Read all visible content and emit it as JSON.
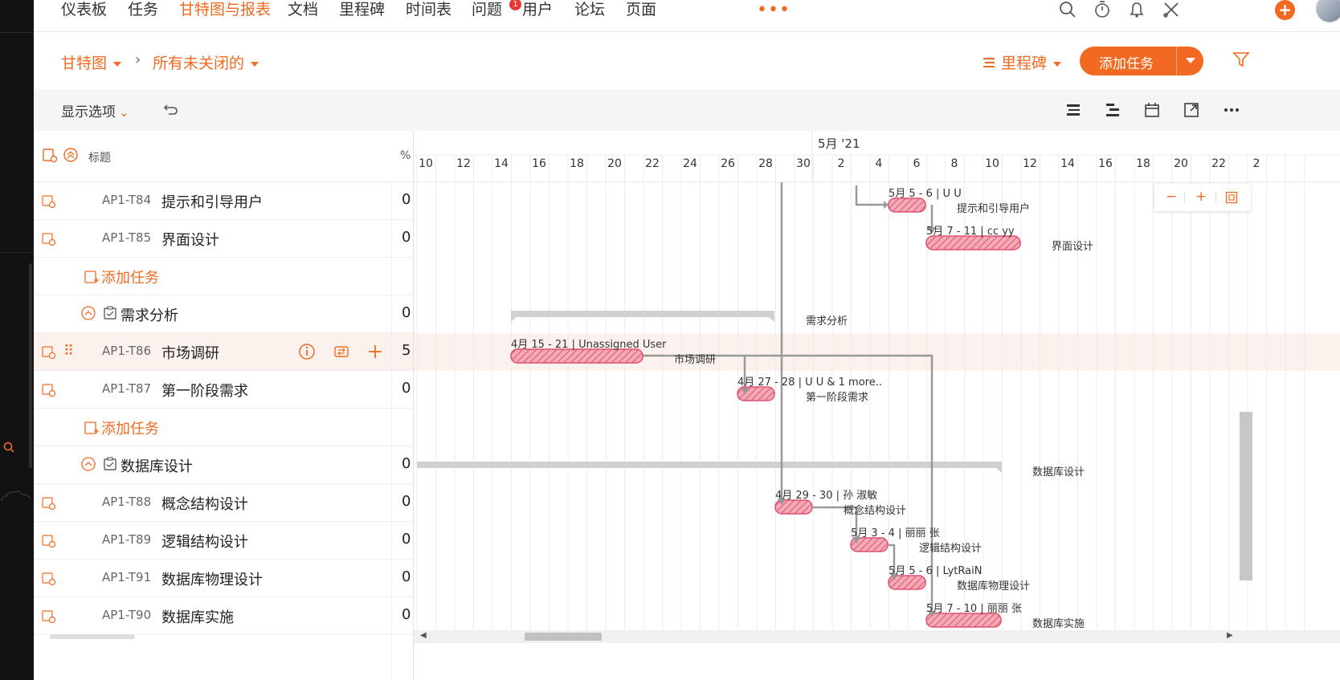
{
  "nav": {
    "items": [
      "仪表板",
      "任务",
      "甘特图与报表",
      "文档",
      "里程碑",
      "时间表",
      "问题",
      "用户",
      "论坛",
      "页面"
    ],
    "active_index": 2,
    "timesheet_badge": "1",
    "more": "•••"
  },
  "crumbs": {
    "root": "甘特图",
    "view": "所有未关闭的",
    "separator": "›",
    "milestone": "里程碑",
    "add_task": "添加任务"
  },
  "toolbar": {
    "display_options": "显示选项"
  },
  "grid": {
    "title_header": "标题",
    "percent_header": "%",
    "rows": [
      {
        "type": "task",
        "code": "AP1-T84",
        "name": "提示和引导用户",
        "value": "0"
      },
      {
        "type": "task",
        "code": "AP1-T85",
        "name": "界面设计",
        "value": "0"
      },
      {
        "type": "add",
        "label": "添加任务"
      },
      {
        "type": "group",
        "name": "需求分析",
        "value": "0"
      },
      {
        "type": "task",
        "code": "AP1-T86",
        "name": "市场调研",
        "value": "5",
        "selected": true
      },
      {
        "type": "task",
        "code": "AP1-T87",
        "name": "第一阶段需求",
        "value": "0"
      },
      {
        "type": "add",
        "label": "添加任务"
      },
      {
        "type": "group",
        "name": "数据库设计",
        "value": "0"
      },
      {
        "type": "task",
        "code": "AP1-T88",
        "name": "概念结构设计",
        "value": "0"
      },
      {
        "type": "task",
        "code": "AP1-T89",
        "name": "逻辑结构设计",
        "value": "0"
      },
      {
        "type": "task",
        "code": "AP1-T91",
        "name": "数据库物理设计",
        "value": "0"
      },
      {
        "type": "task",
        "code": "AP1-T90",
        "name": "数据库实施",
        "value": "0"
      }
    ]
  },
  "timeline": {
    "month_label": "5月 '21",
    "ticks": [
      "10",
      "12",
      "14",
      "16",
      "18",
      "20",
      "22",
      "24",
      "26",
      "28",
      "30",
      "2",
      "4",
      "6",
      "8",
      "10",
      "12",
      "14",
      "16",
      "18",
      "20",
      "22",
      "2"
    ]
  },
  "bars": [
    {
      "info": "5月 5 - 6 | U U",
      "label": "提示和引导用户"
    },
    {
      "info": "5月 7 - 11 | cc yy",
      "label": "界面设计"
    },
    {
      "info": "",
      "label": "需求分析"
    },
    {
      "info": "4月 15 - 21 | Unassigned User",
      "label": "市场调研"
    },
    {
      "info": "4月 27 - 28 | U U & 1 more..",
      "label": "第一阶段需求"
    },
    {
      "info": "",
      "label": "数据库设计"
    },
    {
      "info": "4月 29 - 30 | 孙 淑敏",
      "label": "概念结构设计"
    },
    {
      "info": "5月 3 - 4 | 丽丽 张",
      "label": "逻辑结构设计"
    },
    {
      "info": "5月 5 - 6 | LytRaiN",
      "label": "数据库物理设计"
    },
    {
      "info": "5月 7 - 10 | 丽丽 张",
      "label": "数据库实施"
    }
  ],
  "zoom": {
    "minus": "−",
    "plus": "+"
  },
  "colors": {
    "accent": "#f26a21",
    "bar": "#f07d93"
  }
}
